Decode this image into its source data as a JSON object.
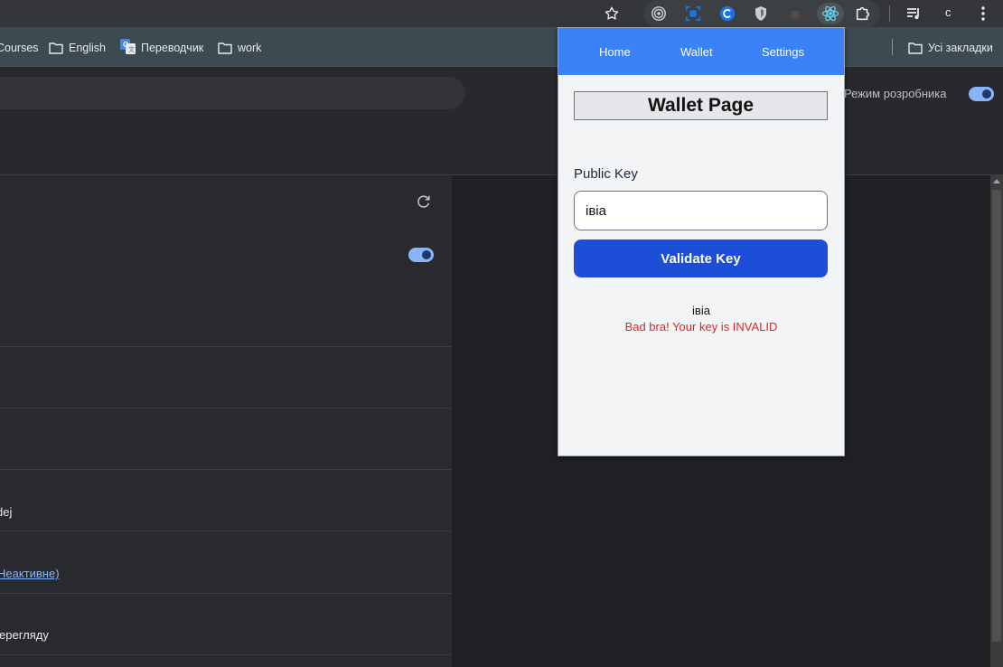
{
  "toolbar": {
    "star_icon": "star-icon",
    "extensions": [
      "radar-icon",
      "scan-icon",
      "circle-c-icon",
      "shield-icon",
      "bug-icon",
      "react-icon",
      "puzzle-icon"
    ],
    "media_icon": "playlist-icon",
    "profile_letter": "c",
    "menu_icon": "kebab-icon"
  },
  "bookmarks": {
    "items": [
      {
        "label": "Courses",
        "icon": "folder-icon"
      },
      {
        "label": "English",
        "icon": "folder-icon"
      },
      {
        "label": "Переводчик",
        "icon": "translate-icon"
      },
      {
        "label": "work",
        "icon": "folder-icon"
      }
    ],
    "all_bookmarks": "Усі закладки"
  },
  "header": {
    "dev_mode_label": "Режим розробника",
    "dev_mode_on": true
  },
  "left_panel": {
    "rows": [
      {
        "text": "dej"
      },
      {
        "text": "Неактивне)",
        "link": true
      },
      {
        "text": "ерегляду"
      }
    ],
    "toggle_on": true
  },
  "popup": {
    "nav": {
      "home": "Home",
      "wallet": "Wallet",
      "settings": "Settings"
    },
    "title": "Wallet Page",
    "public_key_label": "Public Key",
    "public_key_value": "iвia",
    "validate_button": "Validate Key",
    "result_key": "iвia",
    "result_message": "Bad bra! Your key is INVALID",
    "colors": {
      "nav": "#3b82f6",
      "button": "#1d4ed8",
      "error": "#dc2626"
    }
  }
}
